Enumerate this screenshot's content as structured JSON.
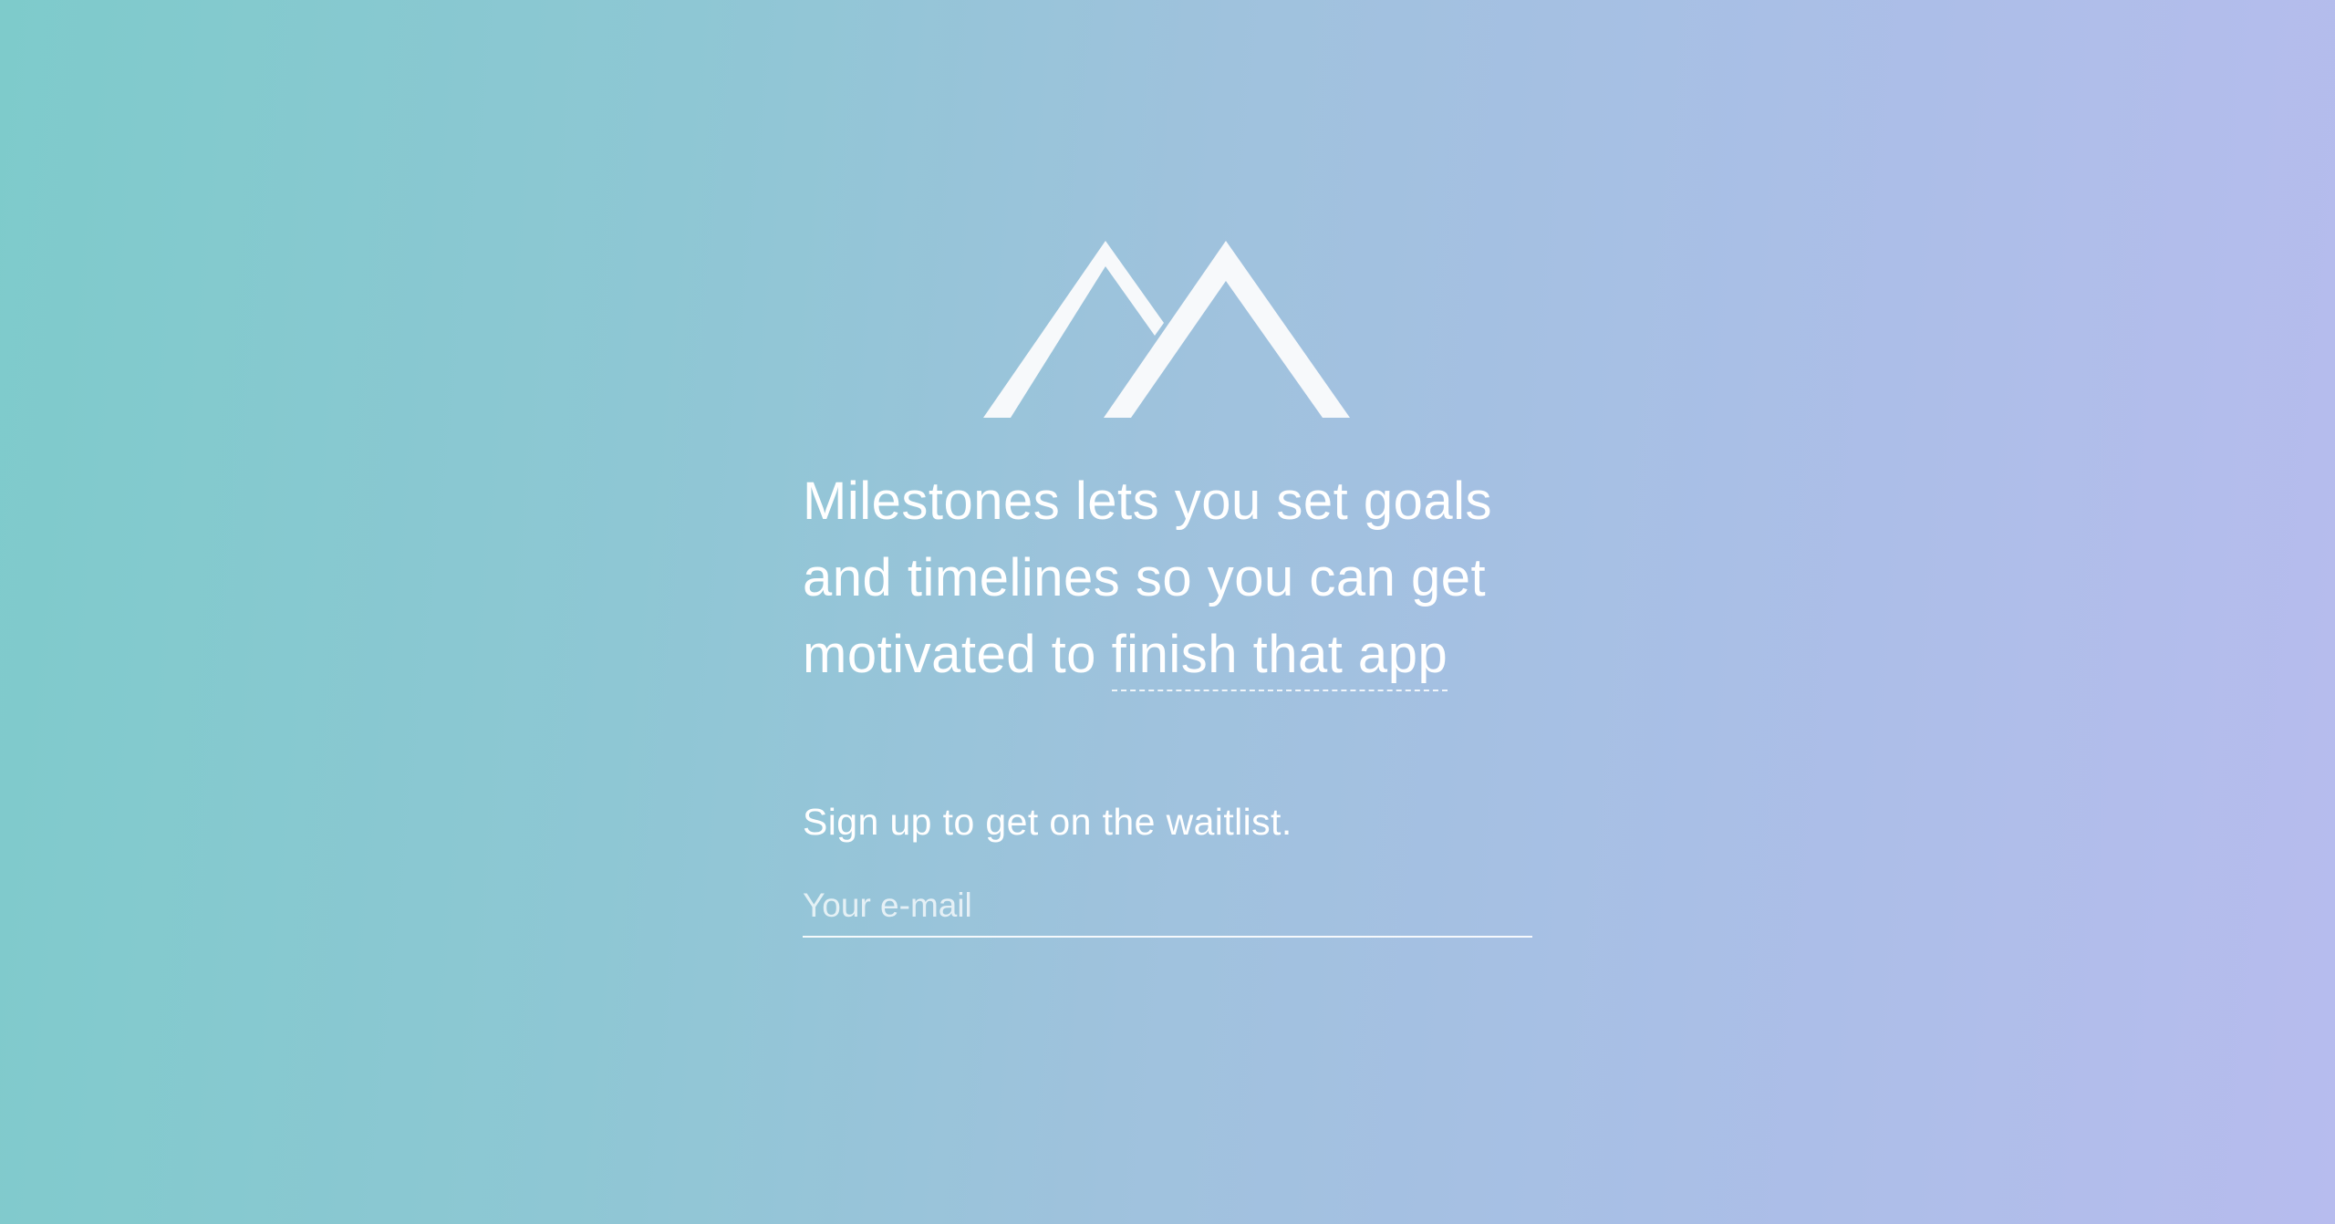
{
  "brand": {
    "logo_icon": "mountains-icon",
    "logo_color": "#f7f9fb"
  },
  "hero": {
    "headline_part1": "Milestones lets you set goals and timelines so you can get motivated to ",
    "headline_highlight": "finish that app"
  },
  "signup": {
    "label": "Sign up to get on the waitlist.",
    "email_placeholder": "Your e-mail",
    "email_value": ""
  },
  "colors": {
    "gradient_start": "#7ecbcb",
    "gradient_end": "#b7bcee",
    "text": "#ffffff"
  }
}
